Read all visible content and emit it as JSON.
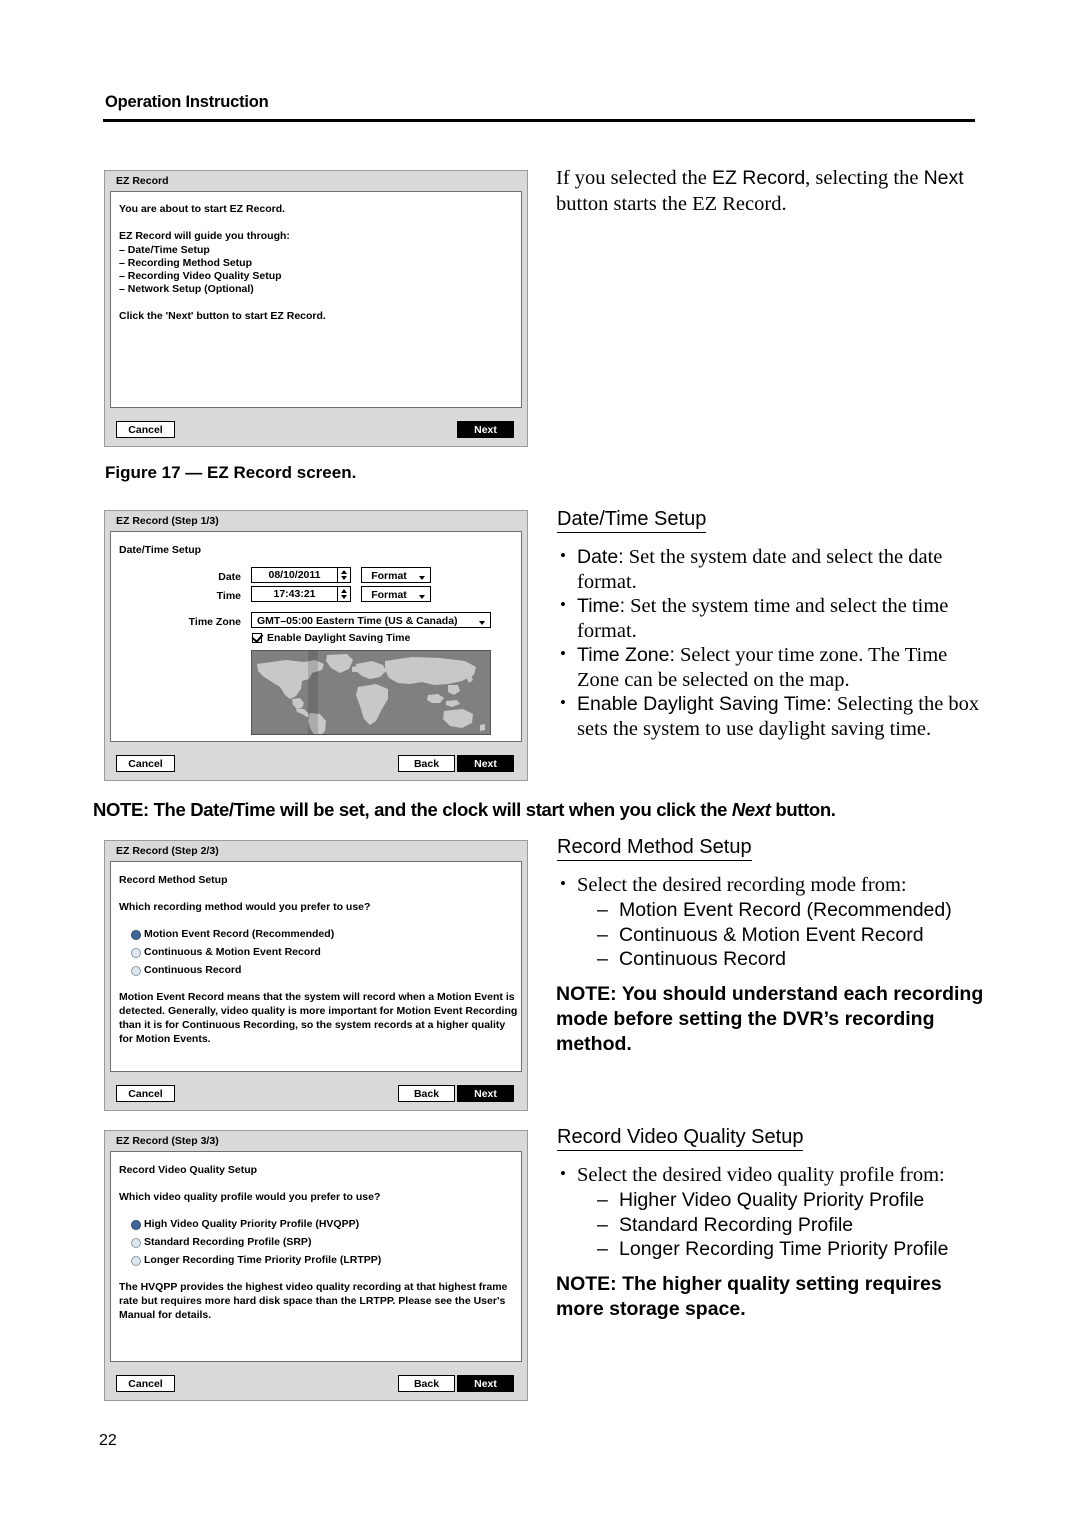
{
  "header": {
    "title": "Operation Instruction"
  },
  "page_number": "22",
  "figure_caption": "Figure 17 — EZ Record screen.",
  "dialogs": {
    "intro": {
      "title": "EZ Record",
      "line1": "You are about to start EZ Record.",
      "guide_heading": "EZ Record will guide you through:",
      "guide_items": [
        "– Date/Time Setup",
        "– Recording Method Setup",
        "– Recording Video Quality Setup",
        "– Network Setup (Optional)"
      ],
      "closing": "Click the 'Next' button to start EZ Record.",
      "cancel_label": "Cancel",
      "next_label": "Next"
    },
    "step1": {
      "title": "EZ Record (Step 1/3)",
      "section_label": "Date/Time Setup",
      "date_label": "Date",
      "date_value": "08/10/2011",
      "date_format_label": "Format",
      "time_label": "Time",
      "time_value": "17:43:21",
      "time_format_label": "Format",
      "timezone_label": "Time Zone",
      "timezone_value": "GMT–05:00  Eastern Time (US & Canada)",
      "dst_label": "Enable Daylight Saving Time",
      "dst_checked": true,
      "cancel_label": "Cancel",
      "back_label": "Back",
      "next_label": "Next"
    },
    "step2": {
      "title": "EZ Record (Step 2/3)",
      "section_label": "Record Method Setup",
      "question": "Which recording method would you prefer to use?",
      "options": [
        {
          "label": "Motion Event Record (Recommended)",
          "selected": true
        },
        {
          "label": "Continuous & Motion Event Record",
          "selected": false
        },
        {
          "label": "Continuous Record",
          "selected": false
        }
      ],
      "description": "Motion Event Record means that the system will record when a Motion Event is detected. Generally, video quality is more important for Motion Event Recording than it is for Continuous Recording, so the system records at a higher quality for Motion Events.",
      "cancel_label": "Cancel",
      "back_label": "Back",
      "next_label": "Next"
    },
    "step3": {
      "title": "EZ Record (Step 3/3)",
      "section_label": "Record Video Quality Setup",
      "question": "Which video quality profile would you prefer to use?",
      "options": [
        {
          "label": "High Video Quality Priority Profile (HVQPP)",
          "selected": true
        },
        {
          "label": "Standard Recording Profile (SRP)",
          "selected": false
        },
        {
          "label": "Longer Recording Time Priority Profile (LRTPP)",
          "selected": false
        }
      ],
      "description": "The HVQPP provides the highest video quality recording at that highest frame rate but requires more hard disk space than the LRTPP. Please see the User's Manual for details.",
      "cancel_label": "Cancel",
      "back_label": "Back",
      "next_label": "Next"
    }
  },
  "content": {
    "intro_paragraph_a": "If you selected the ",
    "intro_paragraph_ez": "EZ Record",
    "intro_paragraph_b": ", selecting the ",
    "intro_paragraph_next": "Next",
    "intro_paragraph_c": " button starts the EZ Record.",
    "datetime": {
      "heading": "Date/Time Setup",
      "items": [
        {
          "term": "Date:",
          "text": " Set the system date and select the date format."
        },
        {
          "term": "Time:",
          "text": " Set the system time and select the time format."
        },
        {
          "term": "Time Zone:",
          "text": " Select your time zone.  The Time Zone can be selected on the map."
        },
        {
          "term": "Enable Daylight Saving Time:",
          "text": " Selecting the box sets the system to use daylight saving time."
        }
      ]
    },
    "note_datetime_a": "NOTE:  The Date/Time will be set, and the clock will start when you click the ",
    "note_datetime_ital": "Next",
    "note_datetime_b": " button.",
    "record_method": {
      "heading": "Record Method Setup",
      "lead": "Select the desired recording mode from:",
      "modes": [
        "Motion Event Record (Recommended)",
        "Continuous & Motion Event Record",
        "Continuous Record"
      ],
      "note": "NOTE:  You should understand each recording mode before setting the DVR’s recording method."
    },
    "video_quality": {
      "heading": "Record Video Quality Setup",
      "lead": "Select the desired video quality profile from:",
      "profiles": [
        "Higher Video Quality Priority Profile",
        "Standard Recording Profile",
        "Longer Recording Time Priority Profile"
      ],
      "note": "NOTE:  The higher quality setting requires more storage space."
    }
  },
  "colors": {
    "dialog_face": "#d9d9d9",
    "dialog_body": "#ffffff",
    "radio_selected": "#3f6699",
    "map_ocean": "#808080",
    "map_land": "#c8c8c8",
    "primary_button": "#000000"
  }
}
